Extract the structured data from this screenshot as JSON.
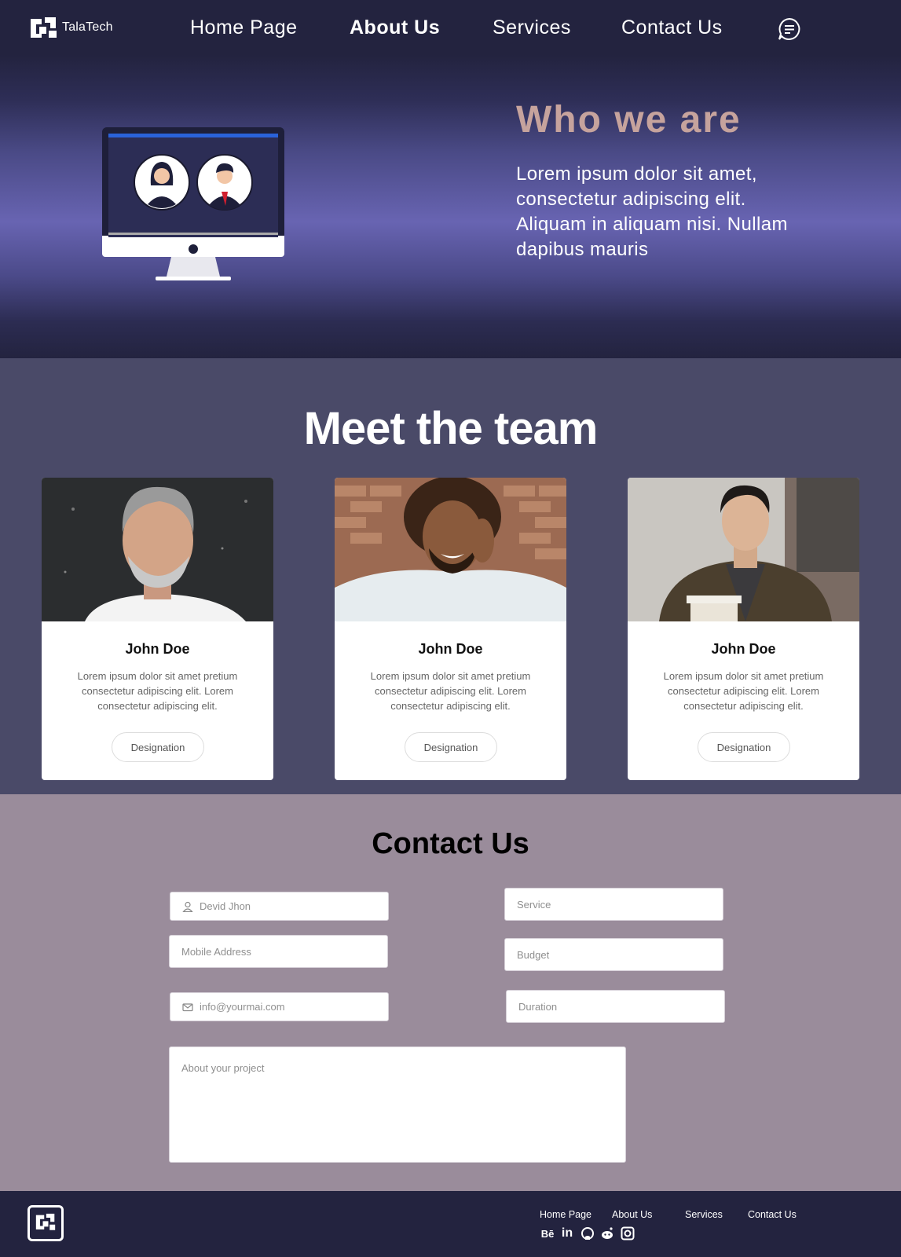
{
  "nav": {
    "brand": "TalaTech",
    "items": [
      {
        "label": "Home Page",
        "active": false
      },
      {
        "label": "About Us",
        "active": true
      },
      {
        "label": "Services",
        "active": false
      },
      {
        "label": "Contact Us",
        "active": false
      }
    ],
    "chat_icon": "chat-bubble-icon"
  },
  "hero": {
    "title": "Who we are",
    "text": "Lorem ipsum dolor sit amet, consectetur adipiscing elit. Aliquam in aliquam nisi. Nullam dapibus mauris",
    "illustration": "monitor-with-two-avatars"
  },
  "team": {
    "title": "Meet the team",
    "members": [
      {
        "name": "John Doe",
        "description": "Lorem ipsum dolor sit amet pretium consectetur adipiscing elit. Lorem consectetur adipiscing elit.",
        "button": "Designation"
      },
      {
        "name": "John Doe",
        "description": "Lorem ipsum dolor sit amet pretium consectetur adipiscing elit. Lorem consectetur adipiscing elit.",
        "button": "Designation"
      },
      {
        "name": "John Doe",
        "description": "Lorem ipsum dolor sit amet pretium consectetur adipiscing elit. Lorem consectetur adipiscing elit.",
        "button": "Designation"
      }
    ]
  },
  "contact": {
    "title": "Contact Us",
    "fields": {
      "name": {
        "placeholder": "Devid Jhon",
        "icon": "user-icon"
      },
      "mobile": {
        "placeholder": "Mobile Address"
      },
      "email": {
        "placeholder": "info@yourmai.com",
        "icon": "mail-icon"
      },
      "service": {
        "placeholder": "Service"
      },
      "budget": {
        "placeholder": "Budget"
      },
      "duration": {
        "placeholder": "Duration"
      },
      "project": {
        "placeholder": "About your project"
      }
    }
  },
  "footer": {
    "links": [
      "Home Page",
      "About Us",
      "Services",
      "Contact Us"
    ],
    "social": [
      {
        "name": "behance-icon",
        "glyph": "Bē"
      },
      {
        "name": "linkedin-icon",
        "glyph": "in"
      },
      {
        "name": "github-icon",
        "glyph": ""
      },
      {
        "name": "reddit-icon",
        "glyph": ""
      },
      {
        "name": "instagram-icon",
        "glyph": ""
      }
    ]
  },
  "colors": {
    "nav_bg": "#23233f",
    "hero_title": "#c6a39d",
    "team_bg": "#4a4a68",
    "contact_bg": "#9a8c9b",
    "footer_bg": "#23233f"
  }
}
